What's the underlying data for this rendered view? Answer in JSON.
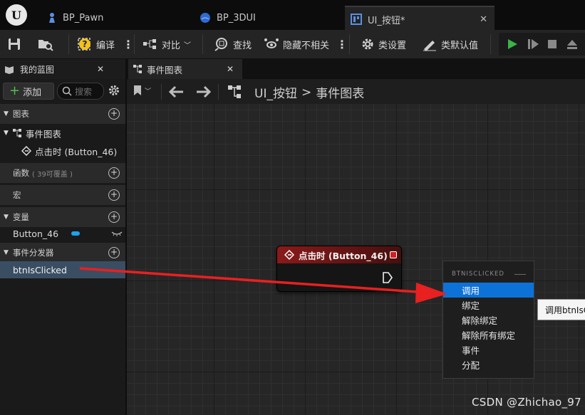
{
  "tabs": [
    {
      "label": "BP_Pawn",
      "icon": "pawn-icon"
    },
    {
      "label": "BP_3DUI",
      "icon": "blueprint-sphere-icon"
    },
    {
      "label": "UI_按钮*",
      "icon": "widget-blueprint-icon",
      "active": true
    }
  ],
  "toolbar": {
    "compile_label": "编译",
    "diff_label": "对比",
    "find_label": "查找",
    "hide_unrelated_label": "隐藏不相关",
    "class_settings_label": "类设置",
    "class_defaults_label": "类默认值"
  },
  "my_blueprint": {
    "title": "我的蓝图",
    "add_label": "添加",
    "search_placeholder": "搜索",
    "sections": {
      "graphs": "图表",
      "event_graph": "事件图表",
      "on_clicked_event": "点击时 (Button_46)",
      "functions": "函数",
      "functions_overridable": "( 39可覆盖 )",
      "macros": "宏",
      "variables": "变量",
      "variable_button": "Button_46",
      "event_dispatchers": "事件分发器",
      "dispatcher_item": "btnIsClicked"
    }
  },
  "graph": {
    "tab_label": "事件图表",
    "breadcrumb_root": "UI_按钮",
    "breadcrumb_separator": ">",
    "breadcrumb_current": "事件图表",
    "node_title": "点击时 (Button_46)"
  },
  "context_menu": {
    "header": "BTNISCLICKED",
    "items": [
      "调用",
      "绑定",
      "解除绑定",
      "解除所有绑定",
      "事件",
      "分配"
    ],
    "selected_index": 0
  },
  "tooltip": {
    "text": "调用btnIsClicked"
  },
  "watermark": "CSDN @Zhichao_97",
  "colors": {
    "accent_selection": "#0d72d8",
    "event_node_header": "#8a1a1a",
    "arrow": "#e82020",
    "play_green": "#3bb34a",
    "variable_pill": "#1fa2ef"
  }
}
